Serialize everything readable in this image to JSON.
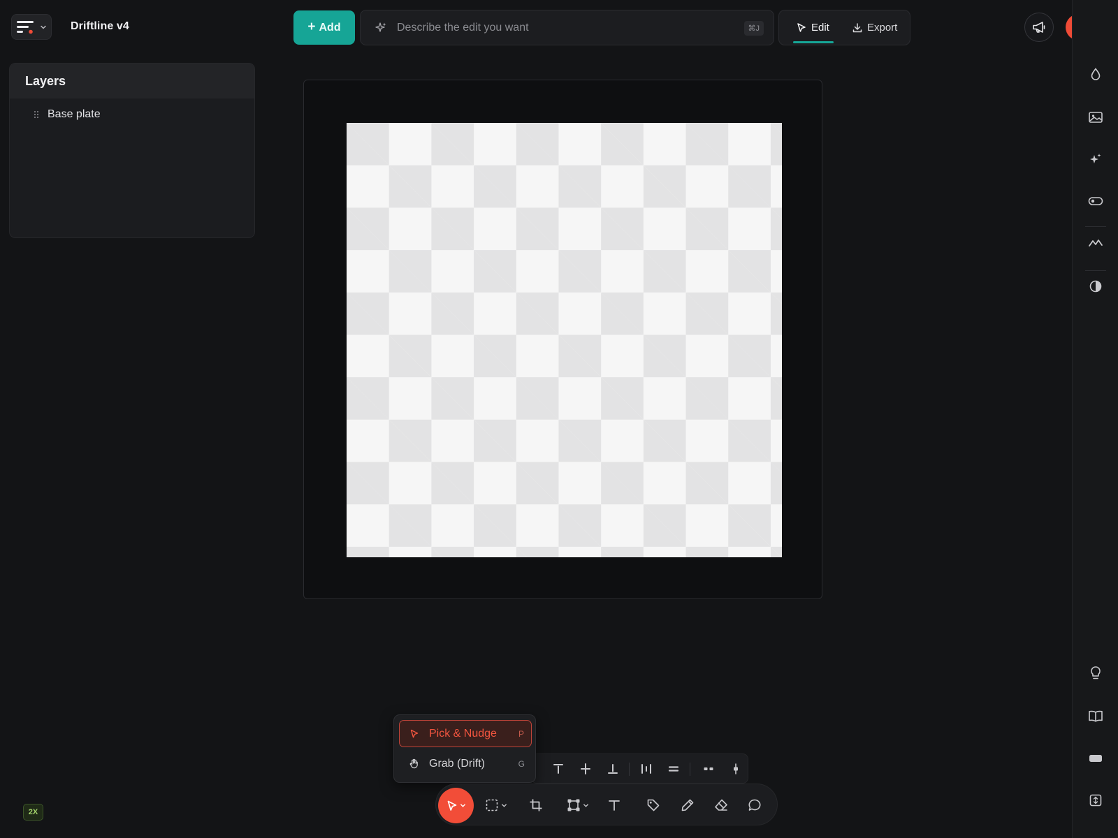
{
  "app": {
    "title": "Driftline v4"
  },
  "header": {
    "add_label": "Add",
    "prompt_placeholder": "Describe the edit you want",
    "prompt_shortcut": "⌘J",
    "modes": [
      "Edit",
      "Export"
    ],
    "active_mode": "Edit"
  },
  "layers": {
    "title": "Layers",
    "items": [
      {
        "label": "Base plate"
      }
    ]
  },
  "tool_menu": {
    "items": [
      {
        "label": "Pick & Nudge",
        "key": "P",
        "active": true
      },
      {
        "label": "Grab (Drift)",
        "key": "G",
        "active": false
      }
    ]
  },
  "zoom": {
    "label": "2X"
  },
  "icons": {
    "right_rail": [
      "droplet-icon",
      "image-icon",
      "sparkle-icon",
      "toggle-icon",
      "waveform-icon",
      "contrast-icon",
      "lightbulb-icon",
      "book-icon",
      "keyboard-icon",
      "resize-icon"
    ],
    "bottom_toolbar": [
      "pointer-icon",
      "marquee-select-icon",
      "crop-icon",
      "transform-icon",
      "text-icon",
      "tag-icon",
      "pencil-icon",
      "eraser-icon",
      "comment-icon"
    ],
    "align_toolbar": [
      "align-top-icon",
      "align-middle-icon",
      "align-bottom-icon",
      "distribute-horizontal-icon",
      "distribute-vertical-icon",
      "spacing-horizontal-icon",
      "spacing-vertical-icon"
    ]
  },
  "colors": {
    "accent": "#16a596",
    "active_tool": "#f24d38",
    "background": "#131416"
  }
}
